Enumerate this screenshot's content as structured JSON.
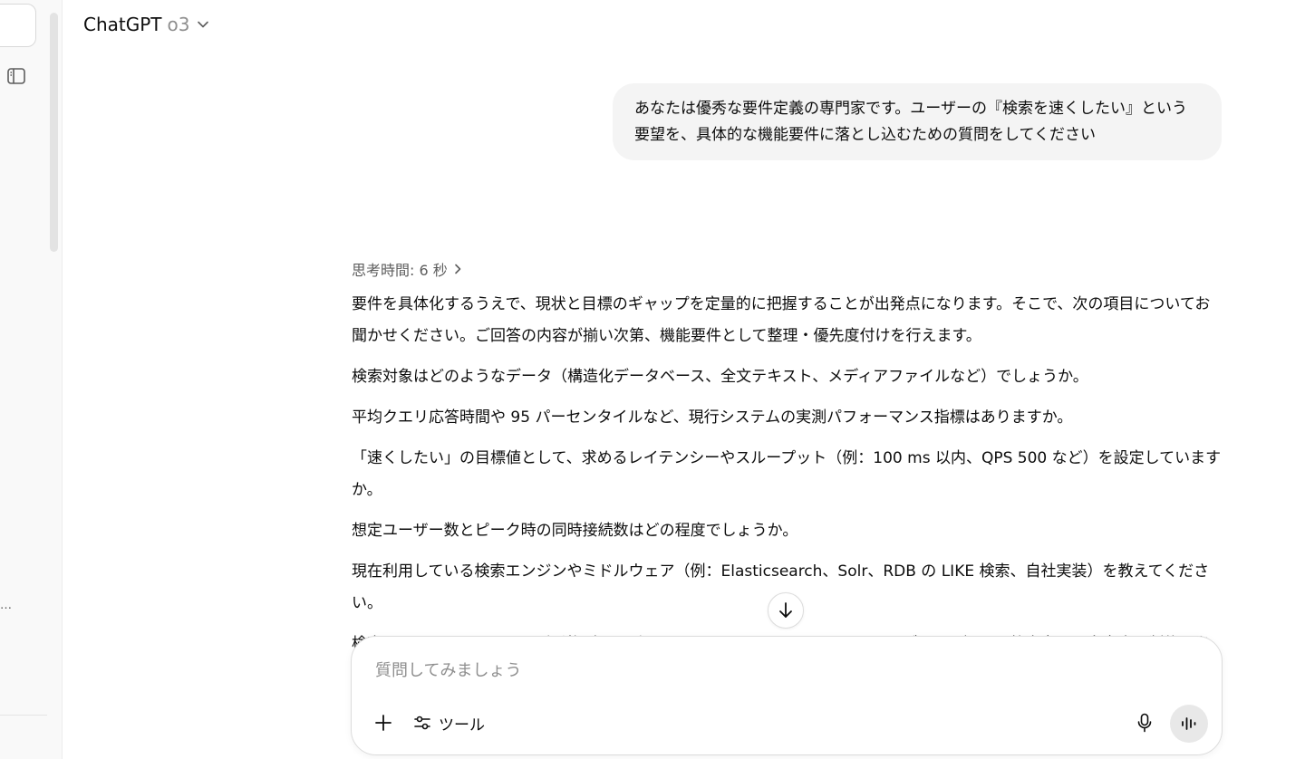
{
  "header": {
    "app_name": "ChatGPT",
    "model": "o3"
  },
  "sidebar": {
    "ellipsis": "…"
  },
  "conversation": {
    "user_message": "あなたは優秀な要件定義の専門家です。ユーザーの『検索を速くしたい』という要望を、具体的な機能要件に落とし込むための質問をしてください",
    "thinking_label": "思考時間: 6 秒",
    "assistant_paragraphs": [
      "要件を具体化するうえで、現状と目標のギャップを定量的に把握することが出発点になります。そこで、次の項目についてお聞かせください。ご回答の内容が揃い次第、機能要件として整理・優先度付けを行えます。",
      "検索対象はどのようなデータ（構造化データベース、全文テキスト、メディアファイルなど）でしょうか。",
      "平均クエリ応答時間や 95 パーセンタイルなど、現行システムの実測パフォーマンス指標はありますか。",
      "「速くしたい」の目標値として、求めるレイテンシーやスループット（例：100 ms 以内、QPS 500 など）を設定していますか。",
      "想定ユーザー数とピーク時の同時接続数はどの程度でしょうか。",
      "現在利用している検索エンジンやミドルウェア（例：Elasticsearch、Solr、RDB の LIKE 検索、自社実装）を教えてください。",
      "検索インフラのホスティング形態（オンプレミス、クラウド IaaS、PaaS、ハイブリッド）と、将来変更の自由度に制約はありますか。"
    ]
  },
  "composer": {
    "placeholder": "質問してみましょう",
    "tools_label": "ツール"
  },
  "icons": {
    "sidebar_toggle": "sidebar-toggle-icon",
    "chevron": "chevron-down-icon",
    "chevron_right": "chevron-right-icon",
    "arrow_down": "arrow-down-icon",
    "plus": "plus-icon",
    "tools": "sliders-icon",
    "mic": "microphone-icon",
    "voice": "voice-waveform-icon"
  },
  "colors": {
    "bubble_bg": "#f4f4f4",
    "muted_text": "#8f8f8f",
    "sidebar_bg": "#f9f9f9"
  }
}
